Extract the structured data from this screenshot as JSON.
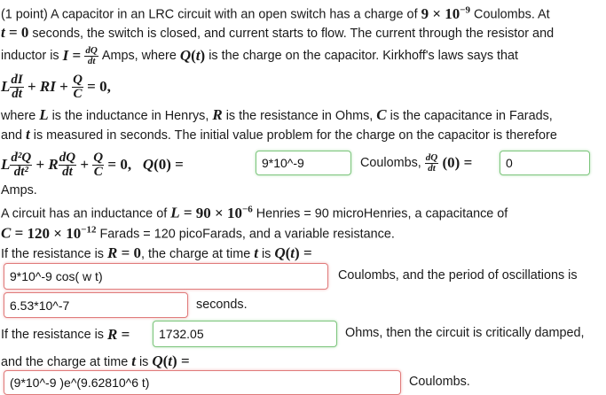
{
  "problem": {
    "points": "(1 point)",
    "intro_a": "A capacitor in an LRC circuit with an open switch has a charge of",
    "charge_expr": "9 × 10",
    "charge_exp": "−9",
    "intro_b": "Coulombs. At",
    "line2": "seconds, the switch is closed, and current starts to flow. The current through the resistor and",
    "inductor_a": "inductor is",
    "amps_where": "Amps, where",
    "is_charge": "is the charge on the capacitor. Kirkhoff's laws says that",
    "where_line": "is the inductance in Henrys,",
    "where_b": "is the resistance in Ohms,",
    "where_c": "is the capacitance in Farads,",
    "and_t": "and",
    "measured": "is measured in seconds. The initial value problem for the charge on the capacitor is therefore",
    "coulombs_lbl": "Coulombs,",
    "amps_lbl": "Amps.",
    "circuit_a": "A circuit has an inductance of",
    "L_val": "90 × 10",
    "L_exp": "−6",
    "henries": "Henries = 90 microHenries, a capacitance of",
    "C_val": "120 × 10",
    "C_exp": "−12",
    "farads": "Farads = 120 picoFarads, and a variable resistance.",
    "if_R0": "If the resistance is",
    "charge_at": ", the charge at time",
    "is_lbl": "is",
    "coulombs_period": "Coulombs, and the period of oscillations is",
    "seconds": "seconds.",
    "if_R1": "If the resistance is",
    "ohms_crit": "Ohms, then the circuit is critically damped,",
    "and_charge": "and the charge at time",
    "coulombs_end": "Coulombs."
  },
  "inputs": {
    "q0": "9*10^-9",
    "dq0": "0",
    "charge_R0": "9*10^-9 cos( w t)",
    "period": "6.53*10^-7",
    "R_crit": "1732.05",
    "charge_crit": "(9*10^-9 )e^(9.62810^6 t)"
  }
}
